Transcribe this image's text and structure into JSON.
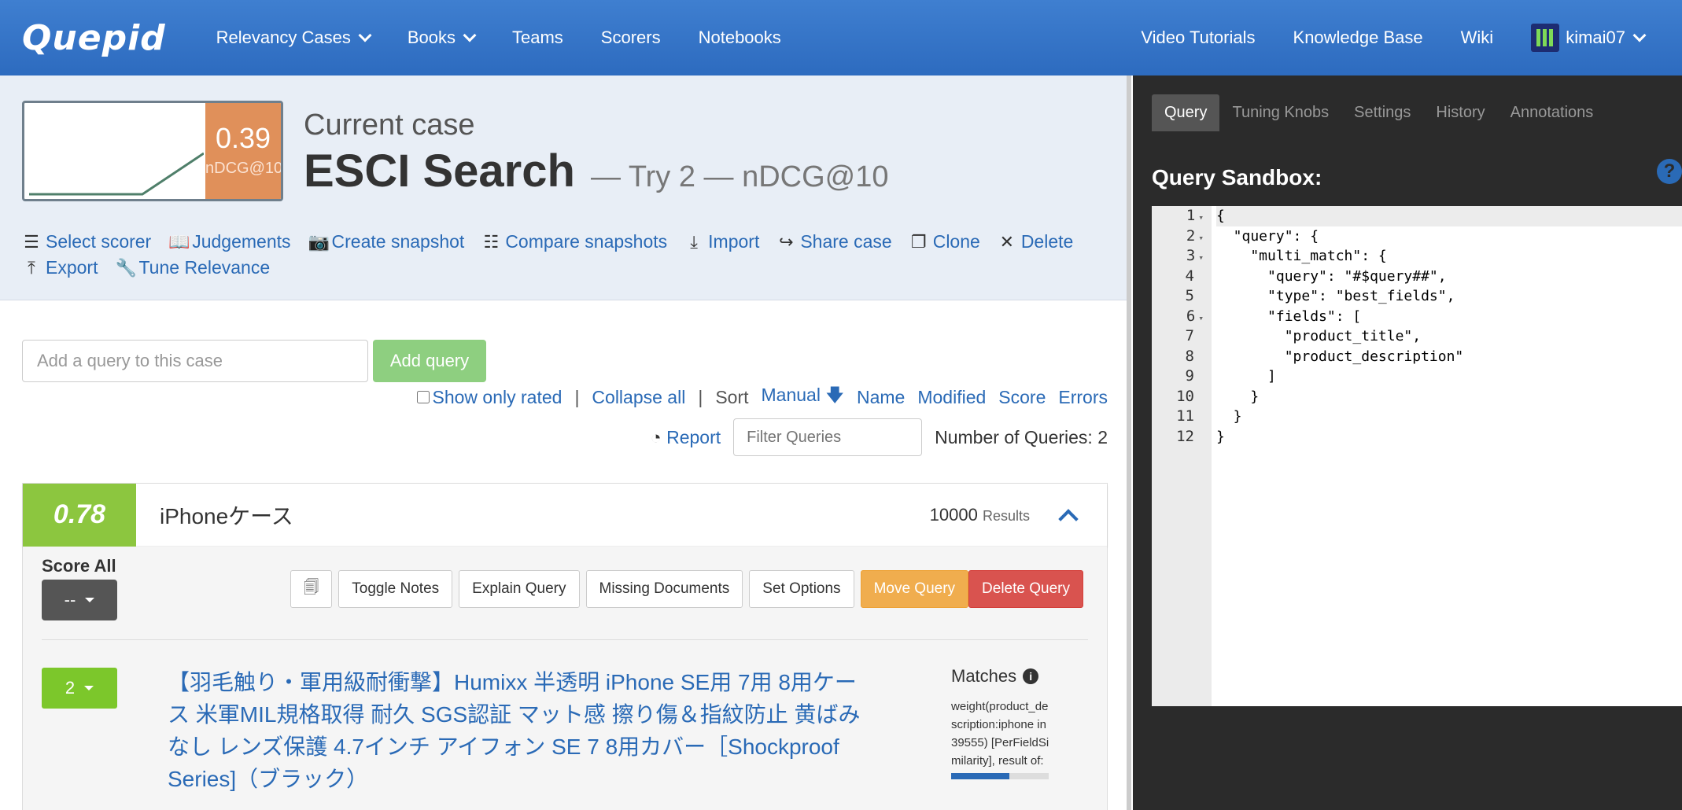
{
  "nav": {
    "brand": "Quepid",
    "left": [
      "Relevancy Cases",
      "Books",
      "Teams",
      "Scorers",
      "Notebooks"
    ],
    "right": [
      "Video Tutorials",
      "Knowledge Base",
      "Wiki"
    ],
    "user": "kimai07"
  },
  "case": {
    "score": "0.39",
    "scorer": "nDCG@10",
    "label": "Current case",
    "name": "ESCI Search",
    "try": "— Try 2 — nDCG@10",
    "actions": [
      "Select scorer",
      "Judgements",
      "Create snapshot",
      "Compare snapshots",
      "Import",
      "Share case",
      "Clone",
      "Delete",
      "Export",
      "Tune Relevance"
    ]
  },
  "query_add": {
    "placeholder": "Add a query to this case",
    "button": "Add query"
  },
  "toolbar": {
    "show_only_rated": "Show only rated",
    "collapse_all": "Collapse all",
    "sort_label": "Sort",
    "sort_options": [
      "Manual",
      "Name",
      "Modified",
      "Score",
      "Errors"
    ],
    "report": "Report",
    "filter_placeholder": "Filter Queries",
    "num_queries": "Number of Queries: 2"
  },
  "query": {
    "score": "0.78",
    "text": "iPhoneケース",
    "results_count": "10000",
    "results_label": "Results",
    "score_all_label": "Score All",
    "score_all_value": "--",
    "buttons": [
      "Toggle Notes",
      "Explain Query",
      "Missing Documents",
      "Set Options"
    ],
    "move": "Move Query",
    "delete": "Delete Query"
  },
  "doc": {
    "rating": "2",
    "title": "【羽毛触り・軍用級耐衝撃】Humixx 半透明 iPhone SE用 7用 8用ケース 米軍MIL規格取得 耐久 SGS認証 マット感 擦り傷＆指紋防止 黄ばみなし レンズ保護 4.7インチ アイフォン SE 7 8用カバー［Shockproof Series]（ブラック）",
    "matches_label": "Matches",
    "matches_text": "weight(product_description:iphone in 39555) [PerFieldSimilarity], result of:",
    "match_fraction": 0.6
  },
  "sidebar": {
    "tabs": [
      "Query",
      "Tuning Knobs",
      "Settings",
      "History",
      "Annotations"
    ],
    "sandbox_title": "Query Sandbox:",
    "code_lines": [
      "{",
      "  \"query\": {",
      "    \"multi_match\": {",
      "      \"query\": \"#$query##\",",
      "      \"type\": \"best_fields\",",
      "      \"fields\": [",
      "        \"product_title\",",
      "        \"product_description\"",
      "      ]",
      "    }",
      "  }",
      "}"
    ],
    "line_numbers": [
      "1",
      "2",
      "3",
      "4",
      "5",
      "6",
      "7",
      "8",
      "9",
      "10",
      "11",
      "12"
    ]
  },
  "colors": {
    "nav": "#3774c6",
    "case_score": "#e0905a",
    "query_score": "#8cc63f",
    "link": "#2a6ab6"
  }
}
